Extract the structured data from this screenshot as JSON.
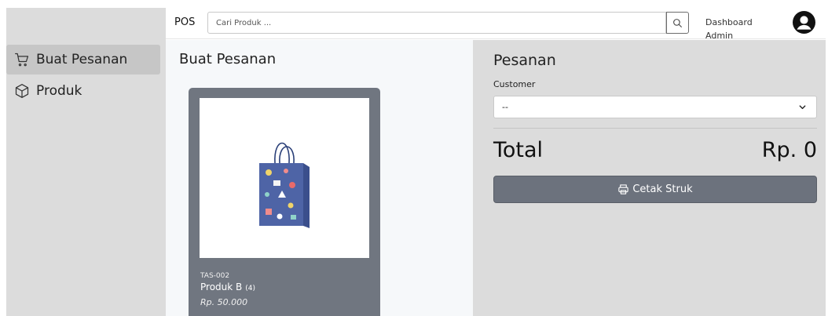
{
  "sidebar": {
    "items": [
      {
        "label": "Buat Pesanan",
        "icon": "cart-icon",
        "active": true
      },
      {
        "label": "Produk",
        "icon": "box-icon",
        "active": false
      }
    ]
  },
  "topbar": {
    "brand": "POS",
    "search_placeholder": "Cari Produk ...",
    "search_icon": "search-icon",
    "dashboard_label": "Dashboard",
    "user_label": "Admin",
    "avatar_icon": "user-icon"
  },
  "main": {
    "title": "Buat Pesanan",
    "products": [
      {
        "sku": "TAS-002",
        "name": "Produk B",
        "stock": "(4)",
        "price": "Rp. 50.000",
        "image": "shopping-bag-image"
      }
    ]
  },
  "order": {
    "title": "Pesanan",
    "customer_label": "Customer",
    "customer_value": "--",
    "total_label": "Total",
    "total_value": "Rp. 0",
    "print_label": "Cetak Struk",
    "print_icon": "printer-icon"
  },
  "colors": {
    "sidebar_bg": "#dcdcdc",
    "card_bg": "#707680",
    "button_bg": "#6c727d",
    "order_bg": "#dcdcdc"
  }
}
